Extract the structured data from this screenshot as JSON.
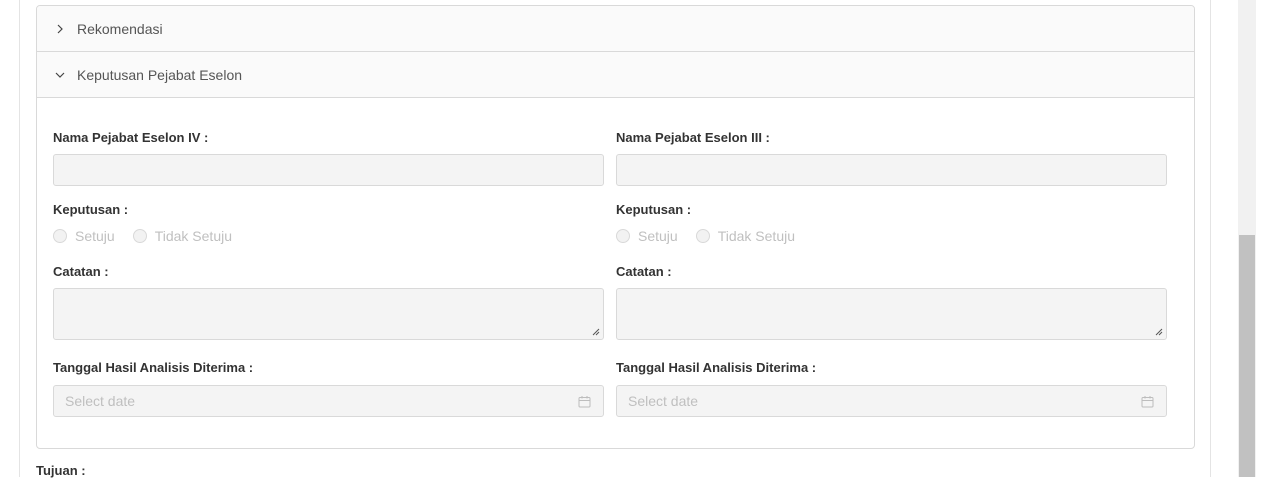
{
  "panels": {
    "rekomendasi": {
      "title": "Rekomendasi",
      "expanded": false
    },
    "keputusan": {
      "title": "Keputusan Pejabat Eselon",
      "expanded": true
    }
  },
  "left": {
    "name_label": "Nama Pejabat Eselon IV :",
    "name_value": "",
    "decision_label": "Keputusan :",
    "options": [
      "Setuju",
      "Tidak Setuju"
    ],
    "notes_label": "Catatan :",
    "notes_value": "",
    "date_label": "Tanggal Hasil Analisis Diterima :",
    "date_placeholder": "Select date"
  },
  "right": {
    "name_label": "Nama Pejabat Eselon III :",
    "name_value": "",
    "decision_label": "Keputusan :",
    "options": [
      "Setuju",
      "Tidak Setuju"
    ],
    "notes_label": "Catatan :",
    "notes_value": "",
    "date_label": "Tanggal Hasil Analisis Diterima :",
    "date_placeholder": "Select date"
  },
  "tujuan_label": "Tujuan :",
  "colors": {
    "border": "#d9d9d9",
    "input_bg": "#f4f4f4",
    "header_bg": "#fafafa"
  },
  "icons": {
    "collapsed": "chevron-right-icon",
    "expanded": "chevron-down-icon",
    "date": "calendar-icon"
  }
}
